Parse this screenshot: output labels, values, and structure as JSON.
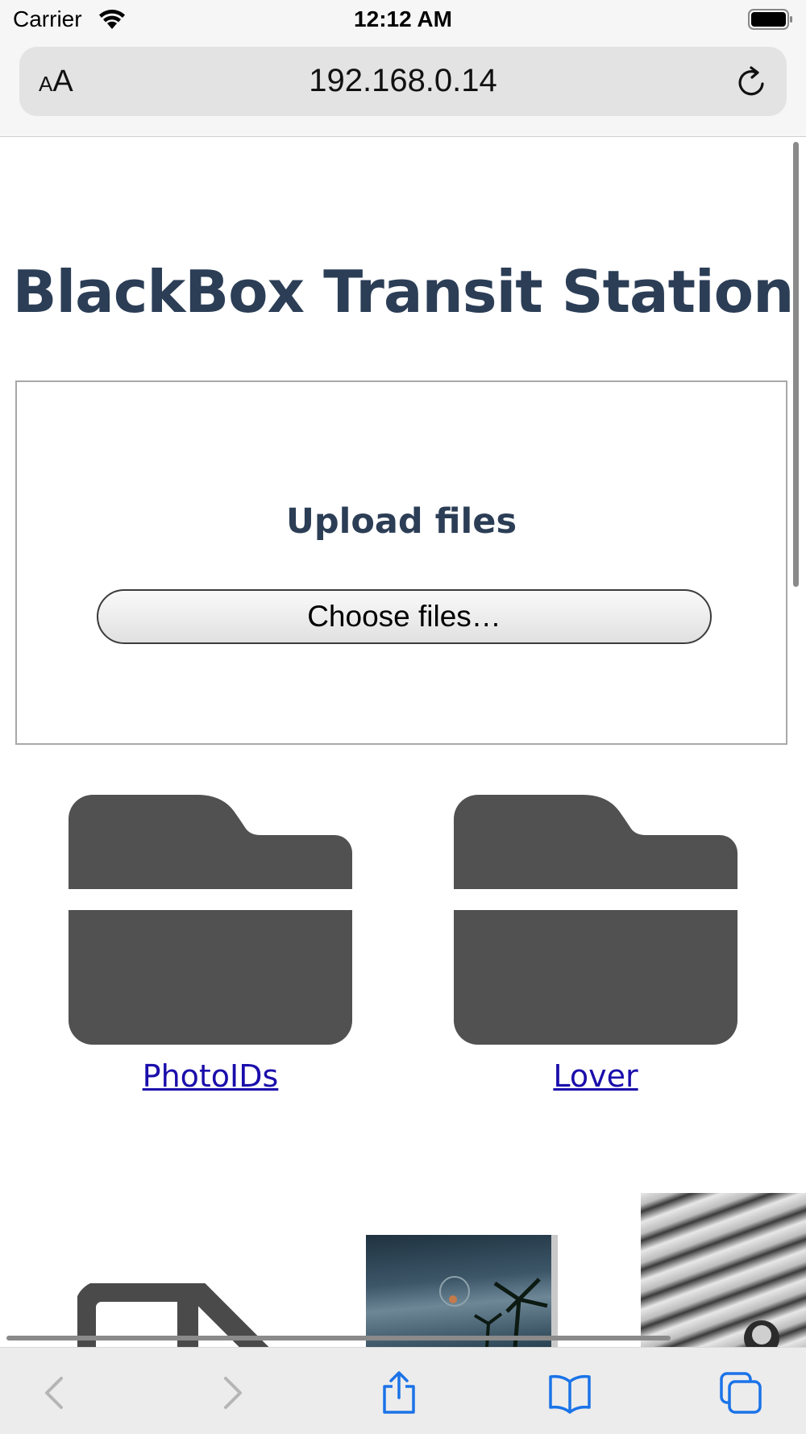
{
  "status_bar": {
    "carrier": "Carrier",
    "time": "12:12 AM"
  },
  "browser": {
    "text_size_label_small": "A",
    "text_size_label_large": "A",
    "url": "192.168.0.14"
  },
  "page": {
    "title": "BlackBox Transit Station",
    "upload": {
      "heading": "Upload files",
      "button_label": "Choose files…"
    },
    "folders": [
      {
        "name": "PhotoIDs"
      },
      {
        "name": "Lover"
      }
    ]
  },
  "toolbar": {
    "items": [
      "back-icon",
      "forward-icon",
      "share-icon",
      "bookmarks-icon",
      "tabs-icon"
    ]
  },
  "colors": {
    "title": "#2c3e56",
    "folder": "#515151",
    "link": "#1a0dab",
    "accent": "#1a73e8"
  }
}
